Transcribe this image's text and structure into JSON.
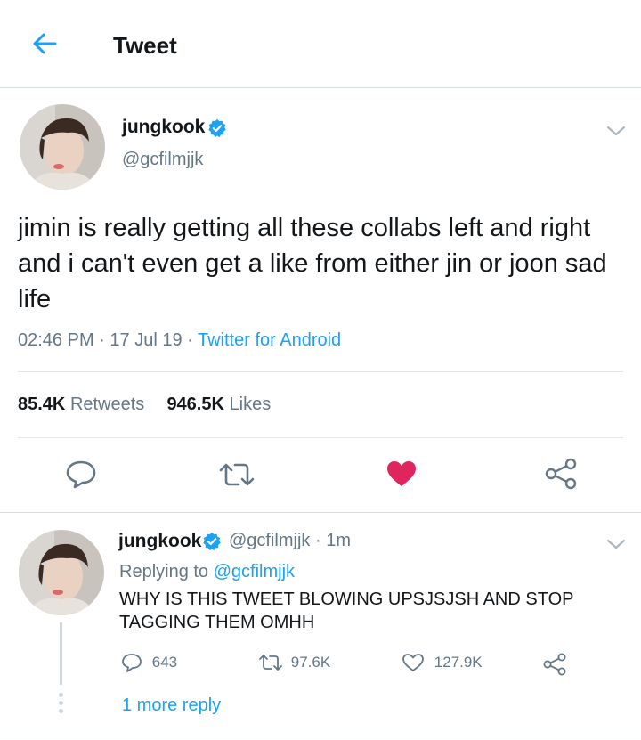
{
  "header": {
    "title": "Tweet",
    "back_icon": "arrow-left-icon"
  },
  "tweet": {
    "author_name": "jungkook",
    "author_handle": "@gcfilmjjk",
    "text": "jimin is really getting all these collabs left and right and i can't even get a like from either jin or joon sad life",
    "time": "02:46 PM",
    "date": "17 Jul 19",
    "source": "Twitter for Android",
    "retweets_count": "85.4K",
    "retweets_label": "Retweets",
    "likes_count": "946.5K",
    "likes_label": "Likes",
    "liked": true
  },
  "reply": {
    "author_name": "jungkook",
    "author_handle": "@gcfilmjjk",
    "time_ago": "1m",
    "replying_prefix": "Replying to",
    "replying_to": "@gcfilmjjk",
    "text": "WHY IS THIS TWEET BLOWING UPSJSJSH AND STOP TAGGING THEM OMHH",
    "reply_count": "643",
    "retweet_count": "97.6K",
    "like_count": "127.9K",
    "more_replies": "1 more reply"
  },
  "colors": {
    "accent": "#1da1f2",
    "like": "#e0245e",
    "muted": "#657786",
    "text": "#14171a"
  }
}
